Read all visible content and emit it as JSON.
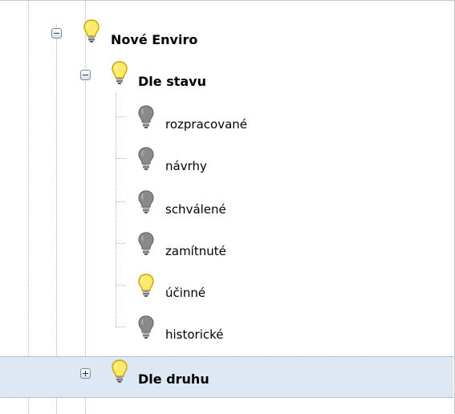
{
  "tree": {
    "root": {
      "label": "Nové Enviro",
      "expanded": true,
      "icon": "bulb-lit-icon",
      "children": [
        {
          "label": "Dle stavu",
          "expanded": true,
          "icon": "bulb-lit-icon",
          "children": [
            {
              "label": "rozpracované",
              "icon": "bulb-off-icon"
            },
            {
              "label": "návrhy",
              "icon": "bulb-off-icon"
            },
            {
              "label": "schválené",
              "icon": "bulb-off-icon"
            },
            {
              "label": "zamítnuté",
              "icon": "bulb-off-icon"
            },
            {
              "label": "účinné",
              "icon": "bulb-lit-icon"
            },
            {
              "label": "historické",
              "icon": "bulb-off-icon"
            }
          ]
        },
        {
          "label": "Dle druhu",
          "expanded": false,
          "selected": true,
          "icon": "bulb-lit-icon"
        }
      ]
    }
  },
  "colors": {
    "bulb_lit": "#ffe96a",
    "bulb_off": "#8a8a8a",
    "selection": "#dee8f5"
  }
}
